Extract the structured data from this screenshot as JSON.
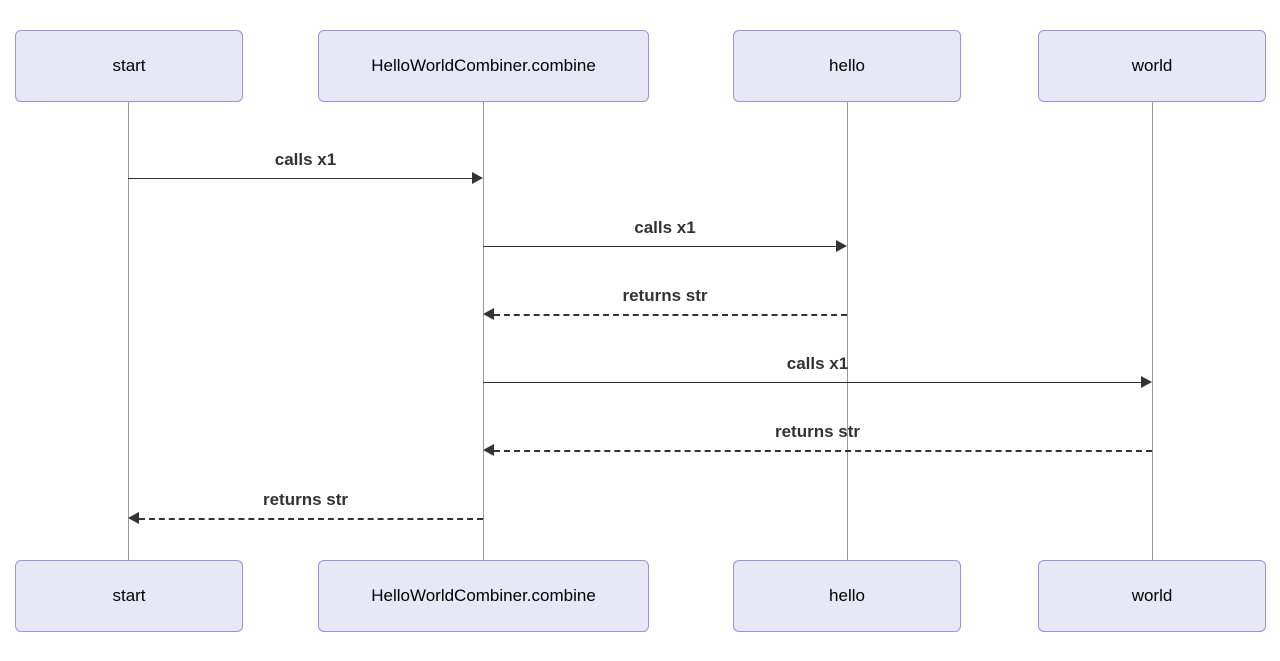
{
  "participants": {
    "p0": {
      "label": "start"
    },
    "p1": {
      "label": "HelloWorldCombiner.combine"
    },
    "p2": {
      "label": "hello"
    },
    "p3": {
      "label": "world"
    }
  },
  "messages": {
    "m0": {
      "label": "calls x1"
    },
    "m1": {
      "label": "calls x1"
    },
    "m2": {
      "label": "returns str"
    },
    "m3": {
      "label": "calls x1"
    },
    "m4": {
      "label": "returns str"
    },
    "m5": {
      "label": "returns str"
    }
  },
  "chart_data": {
    "type": "sequence_diagram",
    "participants": [
      "start",
      "HelloWorldCombiner.combine",
      "hello",
      "world"
    ],
    "interactions": [
      {
        "from": "start",
        "to": "HelloWorldCombiner.combine",
        "label": "calls x1",
        "style": "solid"
      },
      {
        "from": "HelloWorldCombiner.combine",
        "to": "hello",
        "label": "calls x1",
        "style": "solid"
      },
      {
        "from": "hello",
        "to": "HelloWorldCombiner.combine",
        "label": "returns str",
        "style": "dashed"
      },
      {
        "from": "HelloWorldCombiner.combine",
        "to": "world",
        "label": "calls x1",
        "style": "solid"
      },
      {
        "from": "world",
        "to": "HelloWorldCombiner.combine",
        "label": "returns str",
        "style": "dashed"
      },
      {
        "from": "HelloWorldCombiner.combine",
        "to": "start",
        "label": "returns str",
        "style": "dashed"
      }
    ]
  }
}
